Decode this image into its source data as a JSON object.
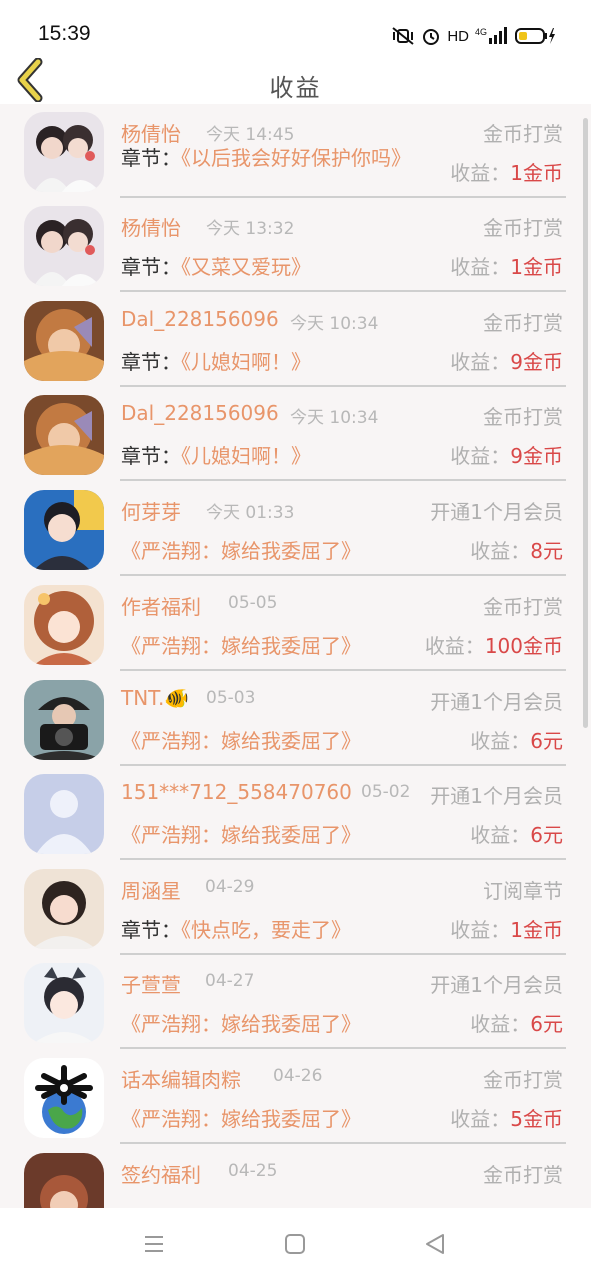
{
  "status": {
    "time": "15:39",
    "hd": "HD",
    "network": "4G"
  },
  "header": {
    "title": "收益"
  },
  "colors": {
    "accent": "#e8956a",
    "income": "#d94848",
    "muted": "#b0b0b0",
    "back_icon": "#e8d24a"
  },
  "rows": [
    {
      "name": "杨倩怡",
      "time": "今天 14:45",
      "type": "金币打赏",
      "chapter_label": "章节：",
      "chapter": "《以后我会好好保护你吗》",
      "income_label": "收益：",
      "income": "1金币",
      "avatar": "couple-photo"
    },
    {
      "name": "杨倩怡",
      "time": "今天 13:32",
      "type": "金币打赏",
      "chapter_label": "章节：",
      "chapter": "《又菜又爱玩》",
      "income_label": "收益：",
      "income": "1金币",
      "avatar": "couple-photo"
    },
    {
      "name": "Dal_228156096",
      "time": "今天 10:34",
      "type": "金币打赏",
      "chapter_label": "章节：",
      "chapter": "《儿媳妇啊！》",
      "income_label": "收益：",
      "income": "9金币",
      "avatar": "bow-girl-photo"
    },
    {
      "name": "Dal_228156096",
      "time": "今天 10:34",
      "type": "金币打赏",
      "chapter_label": "章节：",
      "chapter": "《儿媳妇啊！》",
      "income_label": "收益：",
      "income": "9金币",
      "avatar": "bow-girl-photo"
    },
    {
      "name": "何芽芽",
      "time": "今天 01:33",
      "type": "开通1个月会员",
      "chapter_label": "",
      "chapter": "《严浩翔：嫁给我委屈了》",
      "income_label": "收益：",
      "income": "8元",
      "avatar": "boy-blue-photo"
    },
    {
      "name": "作者福利",
      "time": "05-05",
      "type": "金币打赏",
      "chapter_label": "",
      "chapter": "《严浩翔：嫁给我委屈了》",
      "income_label": "收益：",
      "income": "100金币",
      "avatar": "anime-girl-photo"
    },
    {
      "name": "TNT.🐠",
      "time": "05-03",
      "type": "开通1个月会员",
      "chapter_label": "",
      "chapter": "《严浩翔：嫁给我委屈了》",
      "income_label": "收益：",
      "income": "6元",
      "avatar": "camera-boy-photo"
    },
    {
      "name": "151***712_558470760",
      "time": "05-02",
      "type": "开通1个月会员",
      "chapter_label": "",
      "chapter": "《严浩翔：嫁给我委屈了》",
      "income_label": "收益：",
      "income": "6元",
      "avatar": "default-avatar"
    },
    {
      "name": "周涵星",
      "time": "04-29",
      "type": "订阅章节",
      "chapter_label": "章节：",
      "chapter": "《快点吃，要走了》",
      "income_label": "收益：",
      "income": "1金币",
      "avatar": "girl-bun-photo"
    },
    {
      "name": "子萱萱",
      "time": "04-27",
      "type": "开通1个月会员",
      "chapter_label": "",
      "chapter": "《严浩翔：嫁给我委屈了》",
      "income_label": "收益：",
      "income": "6元",
      "avatar": "boy-catears-photo"
    },
    {
      "name": "话本编辑肉粽",
      "time": "04-26",
      "type": "金币打赏",
      "chapter_label": "",
      "chapter": "《严浩翔：嫁给我委屈了》",
      "income_label": "收益：",
      "income": "5金币",
      "avatar": "earth-logo"
    },
    {
      "name": "签约福利",
      "time": "04-25",
      "type": "金币打赏",
      "chapter_label": "",
      "chapter": "",
      "income_label": "",
      "income": "",
      "avatar": "partial-photo"
    }
  ]
}
